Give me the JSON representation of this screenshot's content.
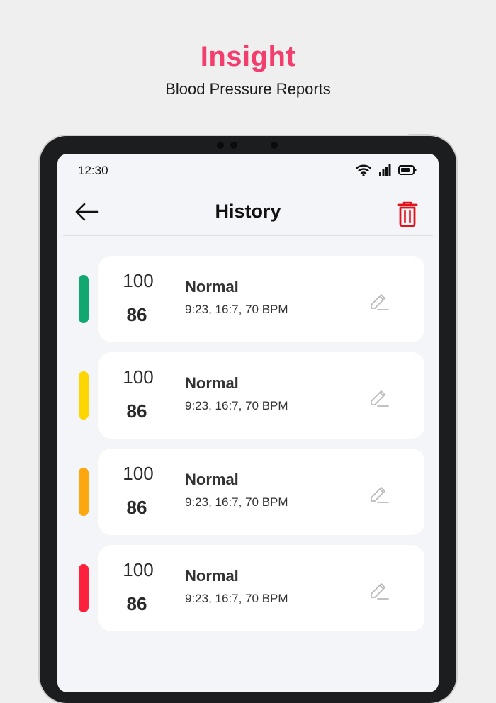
{
  "hero": {
    "title": "Insight",
    "subtitle": "Blood Pressure Reports"
  },
  "status_bar": {
    "time": "12:30"
  },
  "header": {
    "title": "History"
  },
  "colors": {
    "accent": "#f23d6d",
    "delete": "#e0151b",
    "green": "#10a870",
    "yellow": "#fdd600",
    "orange": "#fca70d",
    "red": "#fd213d"
  },
  "records": [
    {
      "systolic": "100",
      "diastolic": "86",
      "status": "Normal",
      "detail": "9:23, 16:7, 70 BPM",
      "indicator_color": "#10a870"
    },
    {
      "systolic": "100",
      "diastolic": "86",
      "status": "Normal",
      "detail": "9:23, 16:7, 70 BPM",
      "indicator_color": "#fdd600"
    },
    {
      "systolic": "100",
      "diastolic": "86",
      "status": "Normal",
      "detail": "9:23, 16:7, 70 BPM",
      "indicator_color": "#fca70d"
    },
    {
      "systolic": "100",
      "diastolic": "86",
      "status": "Normal",
      "detail": "9:23, 16:7, 70 BPM",
      "indicator_color": "#fd213d"
    }
  ]
}
